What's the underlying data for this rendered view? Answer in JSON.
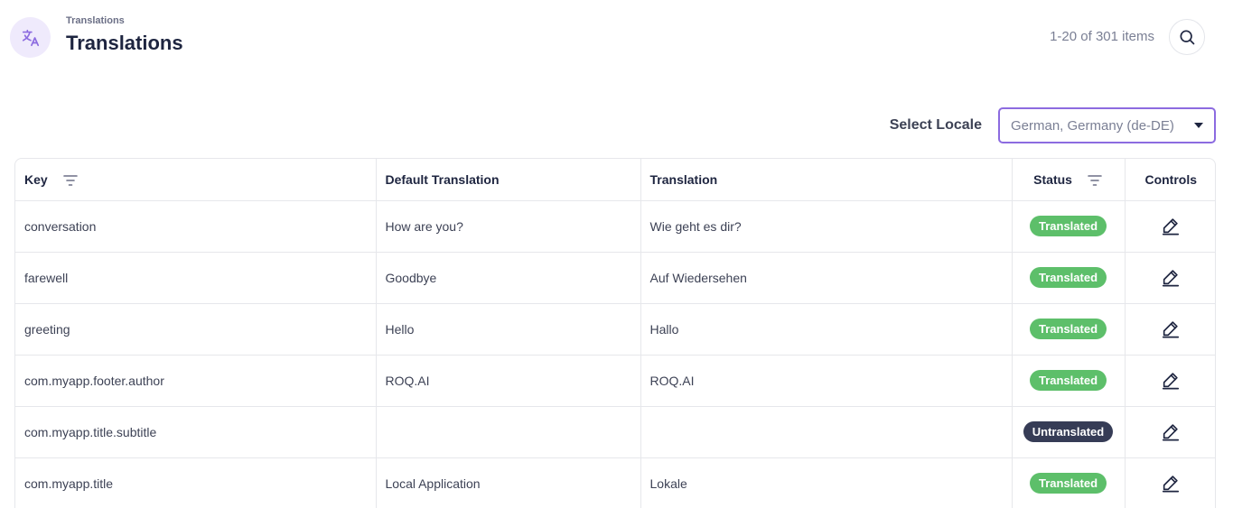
{
  "header": {
    "breadcrumb": "Translations",
    "title": "Translations",
    "items_count": "1-20 of 301 items",
    "icon": "translate-icon"
  },
  "locale": {
    "label": "Select Locale",
    "selected": "German, Germany (de-DE)"
  },
  "table": {
    "columns": {
      "key": "Key",
      "default": "Default Translation",
      "translation": "Translation",
      "status": "Status",
      "controls": "Controls"
    },
    "rows": [
      {
        "key": "conversation",
        "default": "How are you?",
        "translation": "Wie geht es dir?",
        "status": "Translated"
      },
      {
        "key": "farewell",
        "default": "Goodbye",
        "translation": "Auf Wiedersehen",
        "status": "Translated"
      },
      {
        "key": "greeting",
        "default": "Hello",
        "translation": "Hallo",
        "status": "Translated"
      },
      {
        "key": "com.myapp.footer.author",
        "default": "ROQ.AI",
        "translation": "ROQ.AI",
        "status": "Translated"
      },
      {
        "key": "com.myapp.title.subtitle",
        "default": "",
        "translation": "",
        "status": "Untranslated"
      },
      {
        "key": "com.myapp.title",
        "default": "Local Application",
        "translation": "Lokale",
        "status": "Translated"
      }
    ]
  },
  "colors": {
    "accent": "#8c6be0",
    "translated": "#5dbf6a",
    "untranslated": "#363c56"
  }
}
